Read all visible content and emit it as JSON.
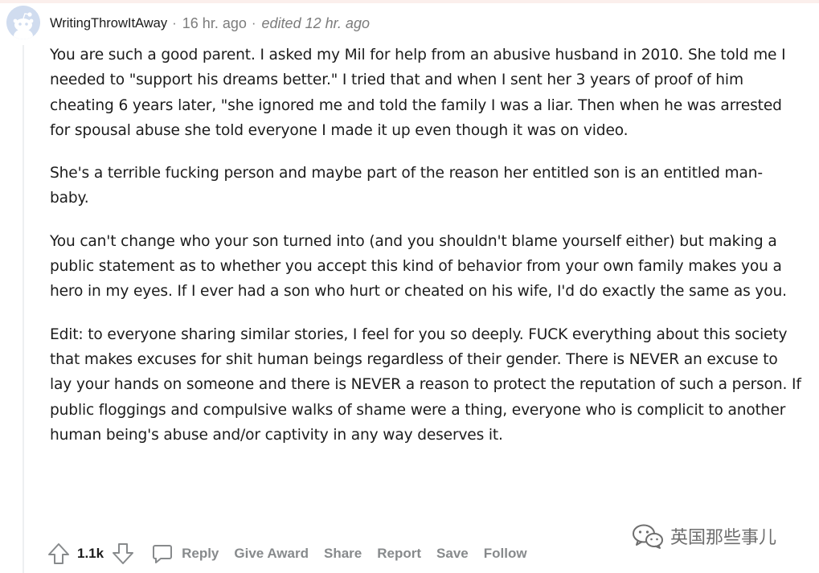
{
  "comment": {
    "author": "WritingThrowItAway",
    "separator": "·",
    "time": "16 hr. ago",
    "edited": "edited 12 hr. ago",
    "paragraphs": [
      "You are such a good parent. I asked my Mil for help from an abusive husband in 2010. She told me I needed to \"support his dreams better.\" I tried that and when I sent her 3 years of proof of him cheating 6 years later, \"she ignored me and told the family I was a liar. Then when he was arrested for spousal abuse she told everyone I made it up even though it was on video.",
      "She's a terrible fucking person and maybe part of the reason her entitled son is an entitled man-baby.",
      "You can't change who your son turned into (and you shouldn't blame yourself either) but making a public statement as to whether you accept this kind of behavior from your own family makes you a hero in my eyes. If I ever had a son who hurt or cheated on his wife, I'd do exactly the same as you.",
      "Edit: to everyone sharing similar stories, I feel for you so deeply. FUCK everything about this society that makes excuses for shit human beings regardless of their gender. There is NEVER an excuse to lay your hands on someone and there is NEVER a reason to protect the reputation of such a person. If public floggings and compulsive walks of shame were a thing, everyone who is complicit to another human being's abuse and/or captivity in any way deserves it."
    ]
  },
  "actions": {
    "score": "1.1k",
    "reply": "Reply",
    "give_award": "Give Award",
    "share": "Share",
    "report": "Report",
    "save": "Save",
    "follow": "Follow"
  },
  "icons": {
    "avatar": "reddit-snoo-avatar-icon",
    "upvote": "upvote-arrow-icon",
    "downvote": "downvote-arrow-icon",
    "reply": "speech-bubble-icon",
    "watermark": "wechat-icon"
  },
  "watermark": {
    "text": "英国那些事儿"
  },
  "colors": {
    "text": "#1c1c1c",
    "meta": "#7c7c7c",
    "action": "#878a8c",
    "avatar_bg": "#d0dcef"
  }
}
